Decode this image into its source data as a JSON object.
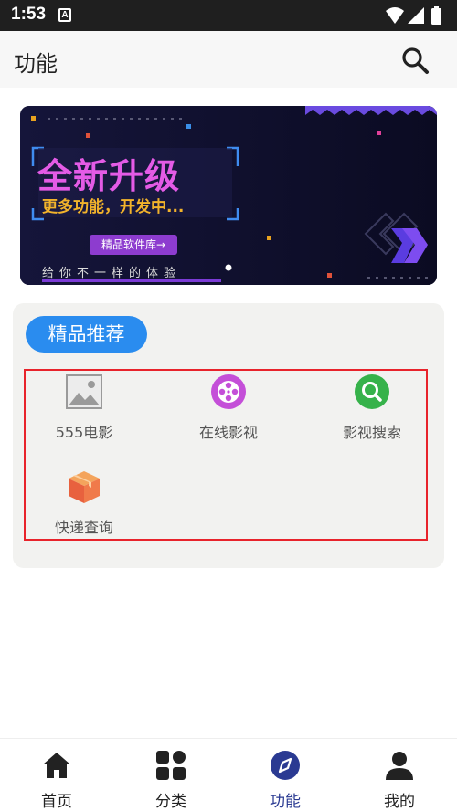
{
  "status_bar": {
    "time": "1:53",
    "badge": "A"
  },
  "app_bar": {
    "title": "功能"
  },
  "banner": {
    "headline": "全新升级",
    "subtitle": "更多功能，开发中...",
    "button_label": "精品软件库→",
    "slogan": "给你不一样的体验"
  },
  "section": {
    "tag": "精品推荐",
    "items": [
      {
        "label": "555电影",
        "icon": "image-placeholder-icon"
      },
      {
        "label": "在线影视",
        "icon": "film-reel-icon",
        "color": "#c44fd8"
      },
      {
        "label": "影视搜索",
        "icon": "search-icon",
        "color": "#36b24a"
      },
      {
        "label": "快递查询",
        "icon": "package-box-icon",
        "color": "#f07a4a"
      }
    ]
  },
  "tab_bar": {
    "tabs": [
      {
        "label": "首页",
        "icon": "home-icon"
      },
      {
        "label": "分类",
        "icon": "category-grid-icon"
      },
      {
        "label": "功能",
        "icon": "compass-icon",
        "active": true
      },
      {
        "label": "我的",
        "icon": "person-icon"
      }
    ]
  },
  "colors": {
    "accent": "#2a8cef",
    "highlight_border": "#e8232b",
    "active_tab": "#2a3a92"
  }
}
